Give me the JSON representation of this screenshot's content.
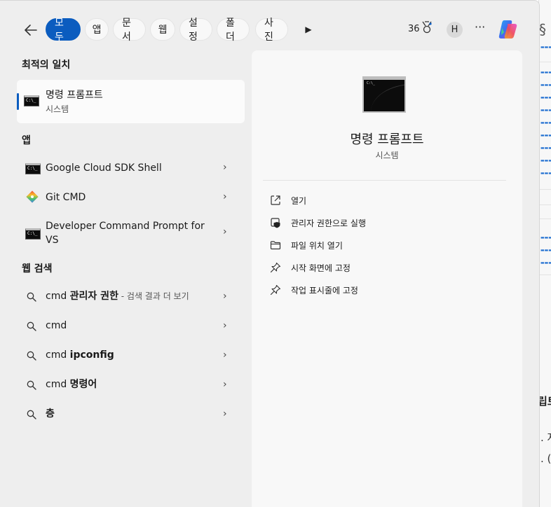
{
  "topbar": {
    "tabs": [
      {
        "label": "모두",
        "active": true
      },
      {
        "label": "앱"
      },
      {
        "label": "문서"
      },
      {
        "label": "웹"
      },
      {
        "label": "설정"
      },
      {
        "label": "폴더"
      },
      {
        "label": "사진"
      }
    ],
    "points": "36",
    "avatar_letter": "H",
    "more": "···"
  },
  "best_match": {
    "section_title": "최적의 일치",
    "title": "명령 프롬프트",
    "subtitle": "시스템"
  },
  "apps": {
    "section_title": "앱",
    "items": [
      {
        "label": "Google Cloud SDK Shell",
        "icon": "cmd-icon"
      },
      {
        "label": "Git CMD",
        "icon": "git-icon"
      },
      {
        "label_line1": "Developer Command Prompt for",
        "label_line2": "VS",
        "icon": "cmd-icon"
      }
    ]
  },
  "web": {
    "section_title": "웹 검색",
    "items": [
      {
        "prefix": "cmd ",
        "bold": "관리자 권한",
        "suffix": " - 검색 결과 더 보기"
      },
      {
        "prefix": "cmd",
        "bold": ""
      },
      {
        "prefix": "cmd ",
        "bold": "ipconfig"
      },
      {
        "prefix": "cmd ",
        "bold": "명령어"
      },
      {
        "prefix": "",
        "bold": "층"
      }
    ]
  },
  "preview": {
    "title": "명령 프롬프트",
    "subtitle": "시스템",
    "actions": [
      {
        "label": "열기",
        "icon": "open-external-icon"
      },
      {
        "label": "관리자 권한으로 실행",
        "icon": "shield-admin-icon"
      },
      {
        "label": "파일 위치 열기",
        "icon": "folder-icon"
      },
      {
        "label": "시작 화면에 고정",
        "icon": "pin-icon"
      },
      {
        "label": "작업 표시줄에 고정",
        "icon": "pin-icon"
      }
    ]
  },
  "background_window": {
    "heading": "립트",
    "text1": ". 자",
    "text2": ". ("
  },
  "colors": {
    "accent": "#0b5cbf",
    "flyout_bg": "#eeeeee",
    "pane_bg": "#f8f8f8"
  }
}
